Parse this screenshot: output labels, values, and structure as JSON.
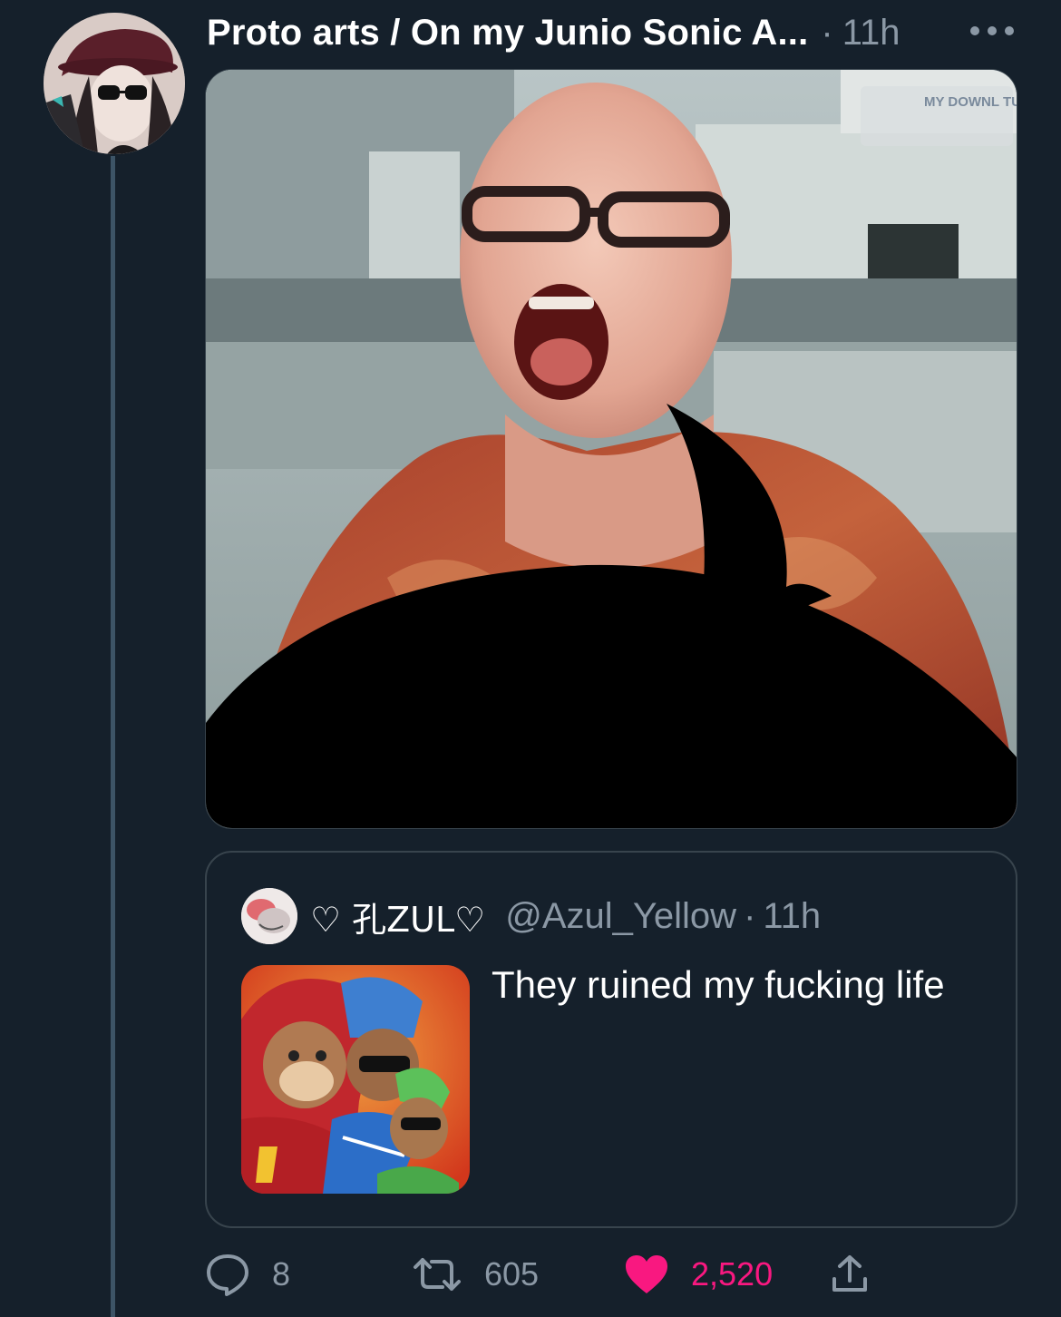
{
  "tweet": {
    "author_name": "Proto arts / On my Junio Sonic A...",
    "separator": "·",
    "time": "11h",
    "avatar_icon": "profile-avatar",
    "more_icon": "more-dots-icon",
    "media_watermark": "MY DOWNL TUBE"
  },
  "quote": {
    "name": "♡ 孔ZUL♡",
    "handle": "@Azul_Yellow",
    "separator": "·",
    "time": "11h",
    "text": "They ruined my fucking life"
  },
  "actions": {
    "reply": {
      "icon": "reply-icon",
      "count": "8"
    },
    "retweet": {
      "icon": "retweet-icon",
      "count": "605"
    },
    "like": {
      "icon": "heart-icon",
      "count": "2,520",
      "color": "#f91880"
    },
    "share": {
      "icon": "share-icon"
    }
  },
  "colors": {
    "background": "#15202b",
    "secondary_text": "#8b98a5",
    "border": "#38444d",
    "like": "#f91880"
  }
}
